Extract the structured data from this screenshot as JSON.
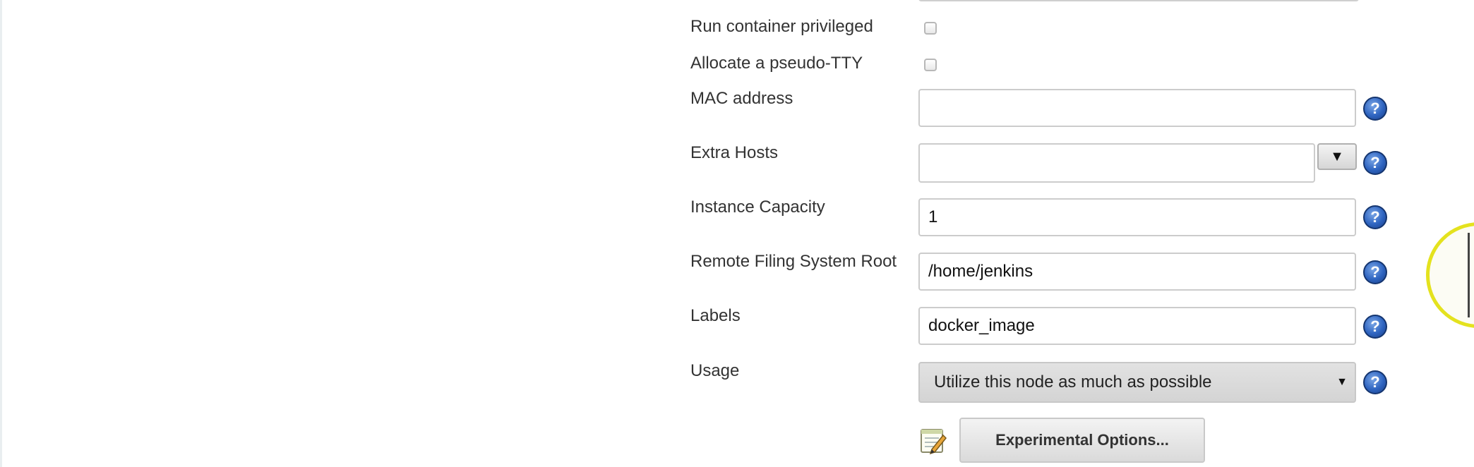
{
  "form": {
    "fields": {
      "run_privileged": {
        "label": "Run container privileged",
        "checked": false
      },
      "pseudo_tty": {
        "label": "Allocate a pseudo-TTY",
        "checked": false
      },
      "mac_address": {
        "label": "MAC address",
        "value": ""
      },
      "extra_hosts": {
        "label": "Extra Hosts",
        "value": "",
        "dropdown_glyph": "▼"
      },
      "instance_capacity": {
        "label": "Instance Capacity",
        "value": "1"
      },
      "remote_fs_root": {
        "label": "Remote Filing System Root",
        "value": "/home/jenkins"
      },
      "labels": {
        "label": "Labels",
        "value": "docker_image"
      },
      "usage": {
        "label": "Usage",
        "selected": "Utilize this node as much as possible",
        "arrow": "▼"
      }
    },
    "help_glyph": "?",
    "experimental_button": "Experimental Options..."
  },
  "icons": {
    "help": "help-icon",
    "experimental": "notepad-pencil-icon"
  },
  "colors": {
    "help_blue": "#2e64c0",
    "cursor_highlight": "#e4e21e"
  }
}
